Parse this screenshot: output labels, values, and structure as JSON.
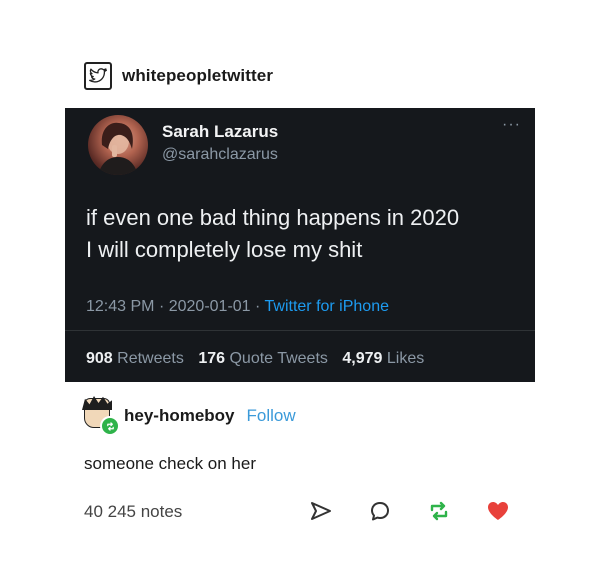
{
  "reblog": {
    "blog_name": "whitepeopletwitter",
    "icon": "twitter-bird-icon"
  },
  "tweet": {
    "display_name": "Sarah Lazarus",
    "handle": "@sarahclazarus",
    "more": "···",
    "text_line1": "if even one bad thing happens in 2020",
    "text_line2": "I will completely lose my shit",
    "time": "12:43 PM",
    "separator": "·",
    "date": "2020-01-01",
    "source": "Twitter for iPhone",
    "retweets_count": "908",
    "retweets_label": "Retweets",
    "quote_count": "176",
    "quote_label": "Quote Tweets",
    "likes_count": "4,979",
    "likes_label": "Likes"
  },
  "reply": {
    "blog_name": "hey-homeboy",
    "follow_label": "Follow",
    "body": "someone check on her"
  },
  "footer": {
    "notes": "40 245 notes",
    "actions": [
      "share-icon",
      "reply-icon",
      "reblog-icon",
      "like-icon"
    ]
  },
  "colors": {
    "tweet_bg": "#15181c",
    "link_blue": "#1d9bf0",
    "follow_blue": "#3b9ad9",
    "reblog_green": "#2fb34a",
    "like_red": "#e8413b"
  }
}
